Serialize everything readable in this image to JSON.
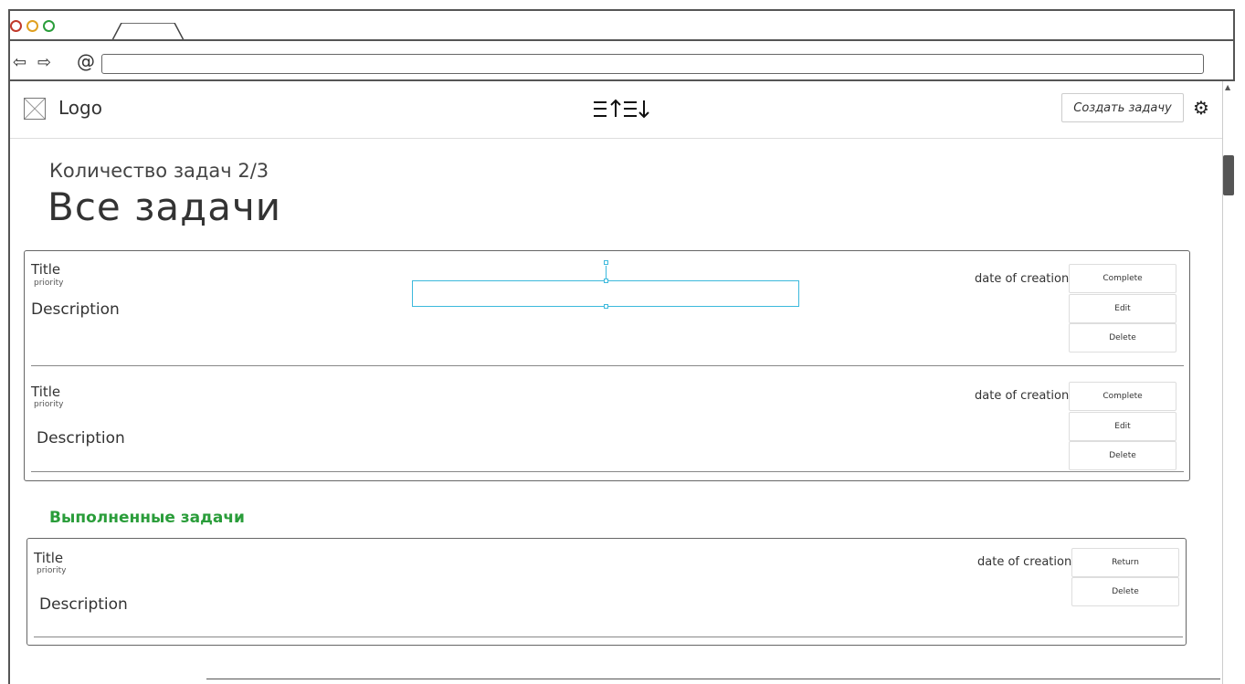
{
  "browser": {
    "back_icon": "arrow-left-icon",
    "forward_icon": "arrow-right-icon",
    "reload_icon": "reload-icon",
    "url": ""
  },
  "header": {
    "logo_label": "Logo",
    "sort_icon": "sort-asc-desc-icon",
    "create_button": "Создать задачу",
    "settings_icon": "gear-icon"
  },
  "summary": {
    "count_text": "Количество задач 2/3",
    "title": "Все задачи"
  },
  "active_tasks": [
    {
      "title": "Title",
      "priority": "priority",
      "description": "Description",
      "date": "date of creation",
      "buttons": [
        "Complete",
        "Edit",
        "Delete"
      ]
    },
    {
      "title": "Title",
      "priority": "priority",
      "description": "Description",
      "date": "date of creation",
      "buttons": [
        "Complete",
        "Edit",
        "Delete"
      ]
    }
  ],
  "completed": {
    "title": "Выполненные задачи",
    "tasks": [
      {
        "title": "Title",
        "priority": "priority",
        "description": "Description",
        "date": "date of creation",
        "buttons": [
          "Return",
          "Delete"
        ]
      }
    ]
  },
  "colors": {
    "completed_heading": "#2a9d3a",
    "selection": "#3cb9dc",
    "dot_red": "#c0392b",
    "dot_yellow": "#e0a020",
    "dot_green": "#2a9d3a"
  }
}
